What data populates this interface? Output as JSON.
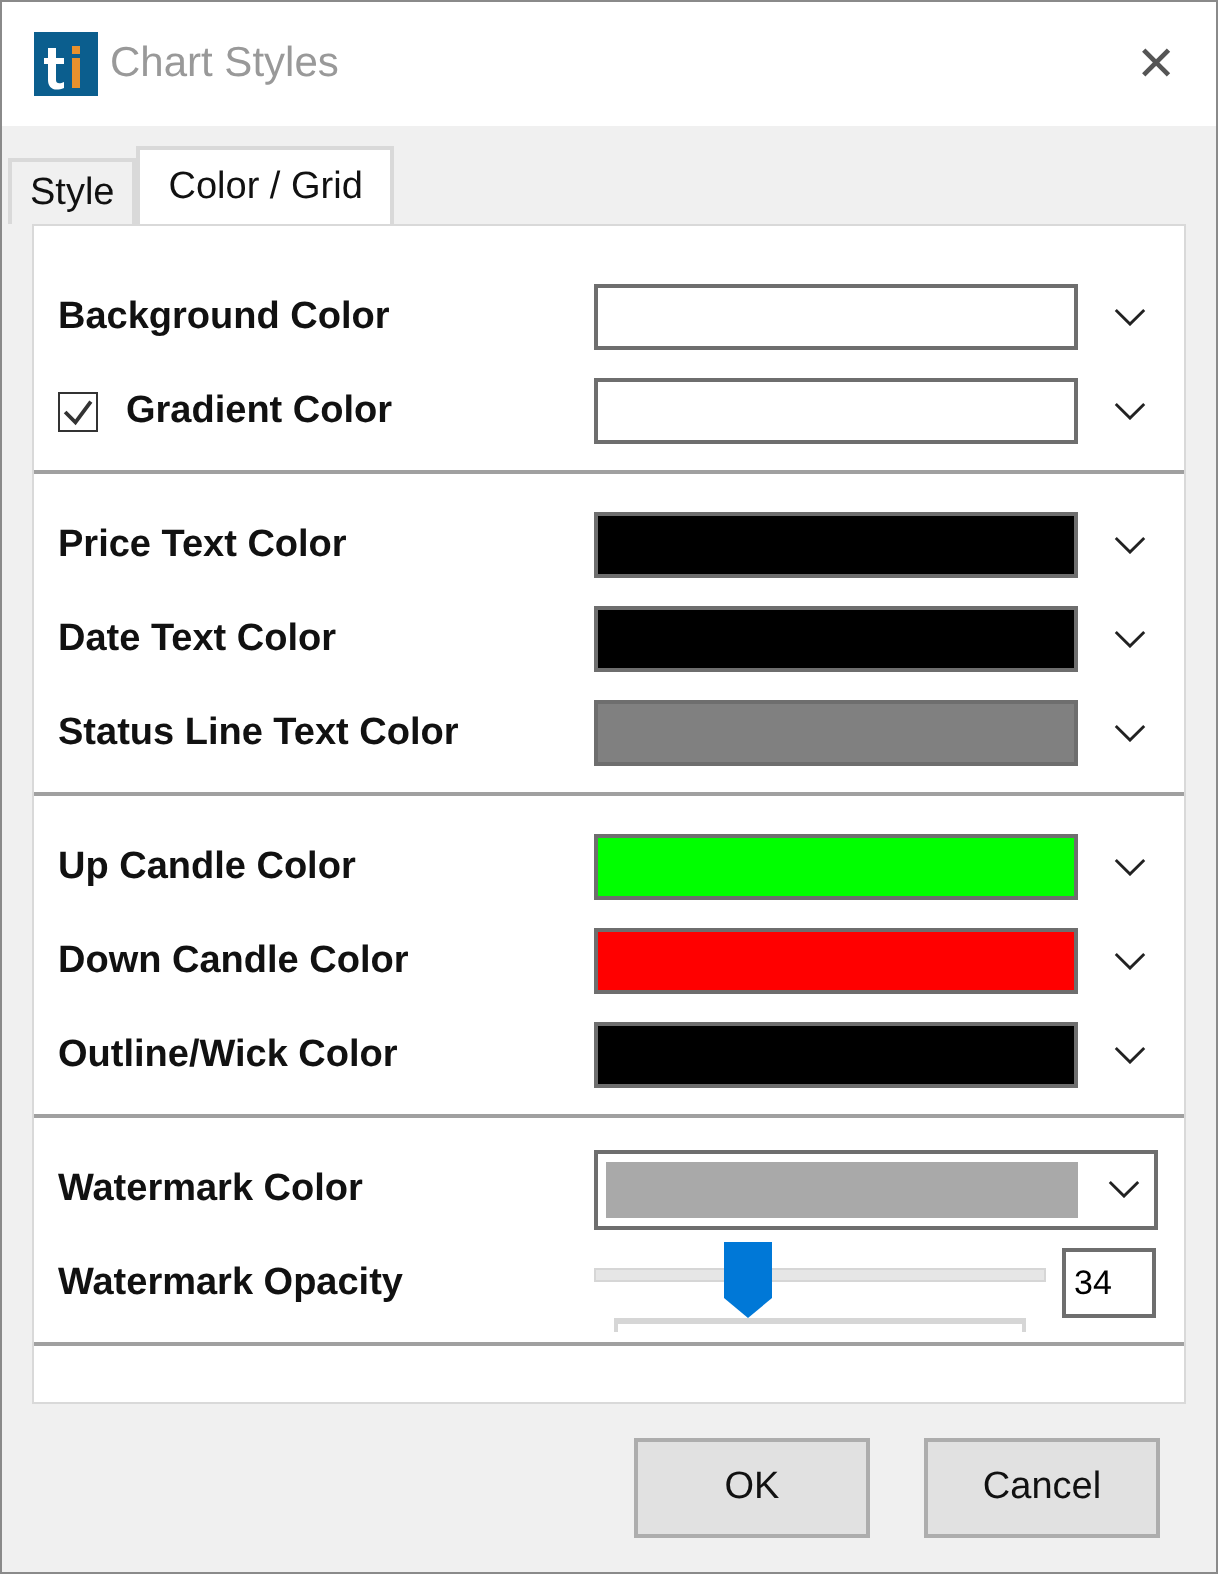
{
  "window": {
    "title": "Chart Styles",
    "close": "✕"
  },
  "tabs": [
    {
      "label": "Style",
      "selected": false
    },
    {
      "label": "Color / Grid",
      "selected": true
    }
  ],
  "groups": [
    {
      "rows": [
        {
          "kind": "swatch",
          "label": "Background Color",
          "color": "#ffffff"
        },
        {
          "kind": "checkswatch",
          "label": "Gradient Color",
          "checked": true,
          "color": "#ffffff"
        }
      ]
    },
    {
      "rows": [
        {
          "kind": "swatch",
          "label": "Price Text Color",
          "color": "#000000"
        },
        {
          "kind": "swatch",
          "label": "Date Text Color",
          "color": "#000000"
        },
        {
          "kind": "swatch",
          "label": "Status Line Text Color",
          "color": "#808080"
        }
      ]
    },
    {
      "rows": [
        {
          "kind": "swatch",
          "label": "Up Candle Color",
          "color": "#00ff00"
        },
        {
          "kind": "swatch",
          "label": "Down Candle Color",
          "color": "#ff0000"
        },
        {
          "kind": "swatch",
          "label": "Outline/Wick Color",
          "color": "#000000"
        }
      ]
    },
    {
      "rows": [
        {
          "kind": "dropdown",
          "label": "Watermark Color",
          "color": "#a9a9a9"
        },
        {
          "kind": "slider",
          "label": "Watermark Opacity",
          "level": 0.34,
          "value": "34"
        }
      ]
    }
  ],
  "buttons": [
    "OK",
    "Cancel"
  ]
}
